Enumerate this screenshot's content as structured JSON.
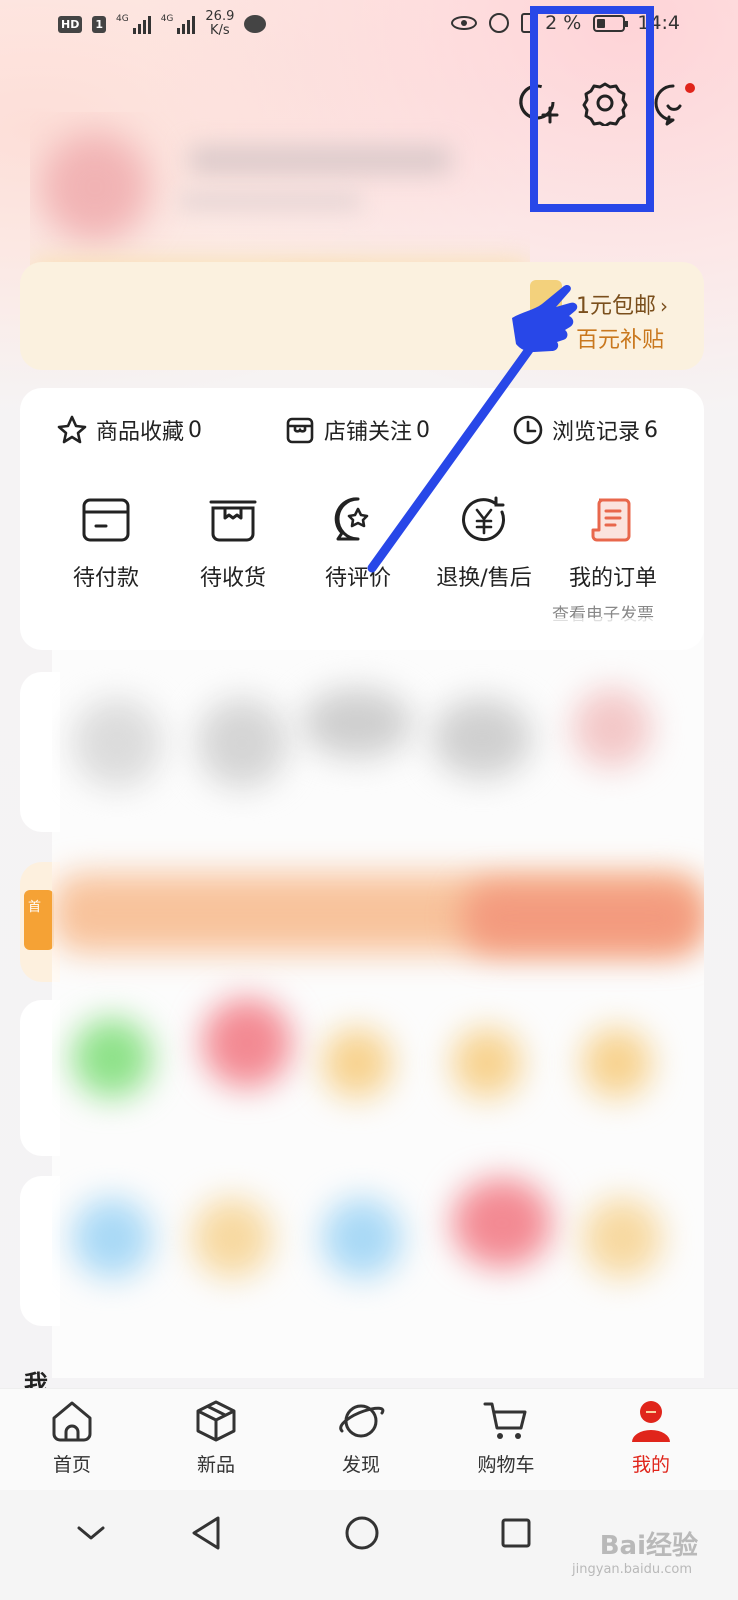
{
  "status_bar": {
    "hd_badge": "HD",
    "sim_badge": "1",
    "net1": "4G",
    "net2": "4G",
    "speed_value": "26.9",
    "speed_unit": "K/s",
    "battery_text": "2 %",
    "time": "14:4"
  },
  "header": {
    "icons": [
      "add-friend-icon",
      "settings-icon",
      "message-icon"
    ],
    "has_unread_dot": true
  },
  "promo": {
    "line1": "1元包邮",
    "line2": "百元补贴",
    "chevron": "›"
  },
  "stats": [
    {
      "label": "商品收藏",
      "count": "0",
      "icon": "star-icon"
    },
    {
      "label": "店铺关注",
      "count": "0",
      "icon": "store-icon"
    },
    {
      "label": "浏览记录",
      "count": "6",
      "icon": "clock-icon"
    }
  ],
  "orders": [
    {
      "label": "待付款",
      "icon": "wallet-icon"
    },
    {
      "label": "待收货",
      "icon": "package-icon"
    },
    {
      "label": "待评价",
      "icon": "review-icon"
    },
    {
      "label": "退换/售后",
      "icon": "refund-icon"
    },
    {
      "label": "我的订单",
      "icon": "order-list-icon"
    }
  ],
  "invoice_link": "查看电子发票",
  "edge_badge": "首",
  "section_title": "我",
  "tabs": [
    {
      "label": "首页",
      "icon": "home-icon",
      "active": false
    },
    {
      "label": "新品",
      "icon": "box-icon",
      "active": false
    },
    {
      "label": "发现",
      "icon": "planet-icon",
      "active": false
    },
    {
      "label": "购物车",
      "icon": "cart-icon",
      "active": false
    },
    {
      "label": "我的",
      "icon": "profile-icon",
      "active": true
    }
  ],
  "watermark": {
    "main": "Bai经验",
    "sub": "jingyan.baidu.com"
  },
  "colors": {
    "accent_red": "#e0251b",
    "promo_gold": "#c9781e",
    "highlight_blue": "#2847e8"
  }
}
